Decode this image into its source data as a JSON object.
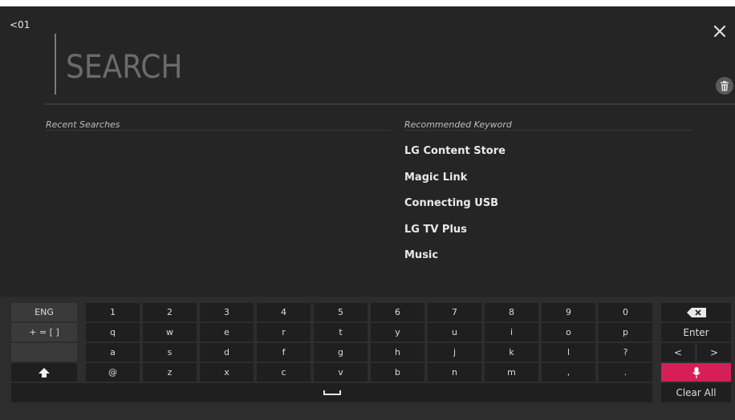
{
  "header": {
    "channel": "<01"
  },
  "search": {
    "placeholder": "SEARCH",
    "value": ""
  },
  "recent": {
    "title": "Recent Searches",
    "items": []
  },
  "recommended": {
    "title": "Recommended Keyword",
    "items": [
      "LG Content Store",
      "Magic Link",
      "Connecting USB",
      "LG TV Plus",
      "Music"
    ]
  },
  "keyboard": {
    "lang": "ENG",
    "symbols": "+ = [ ]",
    "row1": [
      "1",
      "2",
      "3",
      "4",
      "5",
      "6",
      "7",
      "8",
      "9",
      "0"
    ],
    "row2": [
      "q",
      "w",
      "e",
      "r",
      "t",
      "y",
      "u",
      "i",
      "o",
      "p"
    ],
    "row3": [
      "a",
      "s",
      "d",
      "f",
      "g",
      "h",
      "j",
      "k",
      "l",
      "?"
    ],
    "row4": [
      "@",
      "z",
      "x",
      "c",
      "v",
      "b",
      "n",
      "m",
      ",",
      "."
    ],
    "enter": "Enter",
    "left": "<",
    "right": ">",
    "clear_all": "Clear All"
  },
  "colors": {
    "accent": "#d71f57",
    "background": "#252525"
  }
}
